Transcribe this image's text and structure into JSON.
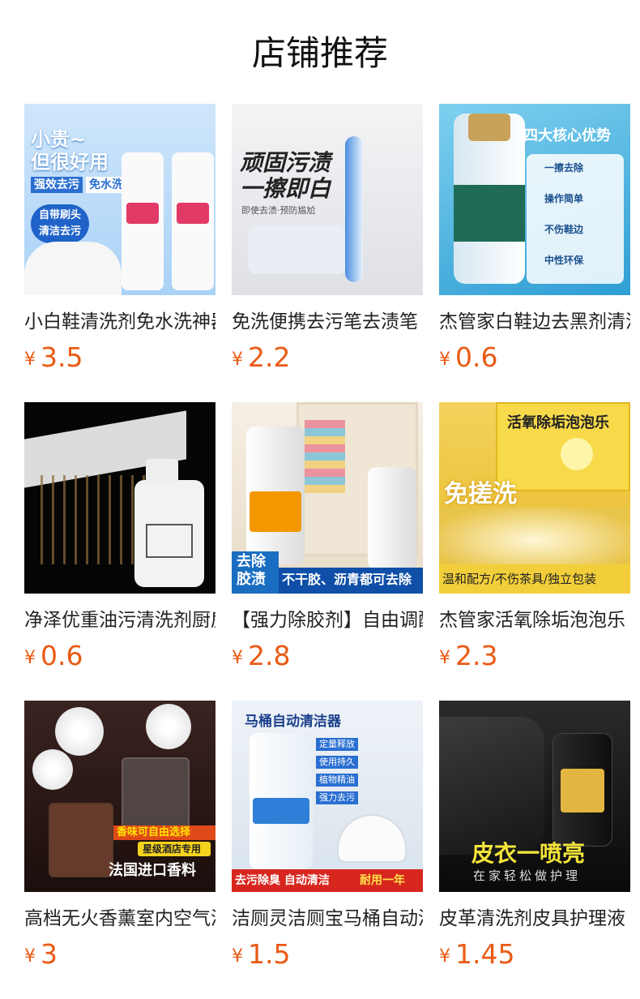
{
  "section_title": "店铺推荐",
  "currency": "¥",
  "products": [
    {
      "name": "小白鞋清洗剂免水洗神器",
      "price": "3.5",
      "image_text": [
        "小贵~",
        "但很好用",
        "强效去污",
        "免水洗",
        "自带刷头",
        "清洁去污"
      ]
    },
    {
      "name": "免洗便携去污笔去渍笔",
      "price": "2.2",
      "image_text": [
        "顽固污渍",
        "一擦即白",
        "即使去渍·预防尴尬"
      ]
    },
    {
      "name": "杰管家白鞋边去黑剂清洁",
      "price": "0.6",
      "image_text": [
        "四大核心优势",
        "一擦去除",
        "操作简单",
        "不伤鞋边",
        "中性环保"
      ]
    },
    {
      "name": "净泽优重油污清洗剂厨房",
      "price": "0.6",
      "image_text": []
    },
    {
      "name": "【强力除胶剂】自由调配",
      "price": "2.8",
      "image_text": [
        "去除",
        "胶渍",
        "不干胶、沥青都可去除"
      ]
    },
    {
      "name": "杰管家活氧除垢泡泡乐",
      "price": "2.3",
      "image_text": [
        "活氧除垢泡泡乐",
        "免搓洗",
        "温和配方/不伤茶具/独立包装"
      ]
    },
    {
      "name": "高档无火香薰室内空气清新",
      "price": "3",
      "image_text": [
        "香味可自由选择",
        "星级酒店专用",
        "法国进口香料"
      ]
    },
    {
      "name": "洁厕灵洁厕宝马桶自动清洁",
      "price": "1.5",
      "image_text": [
        "马桶自动清洁器",
        "定量释放",
        "使用持久",
        "植物精油",
        "强力去污",
        "去污除臭 自动清洁",
        "耐用一年"
      ]
    },
    {
      "name": "皮革清洗剂皮具护理液",
      "price": "1.45",
      "image_text": [
        "皮衣一喷亮",
        "在家轻松做护理"
      ]
    }
  ]
}
